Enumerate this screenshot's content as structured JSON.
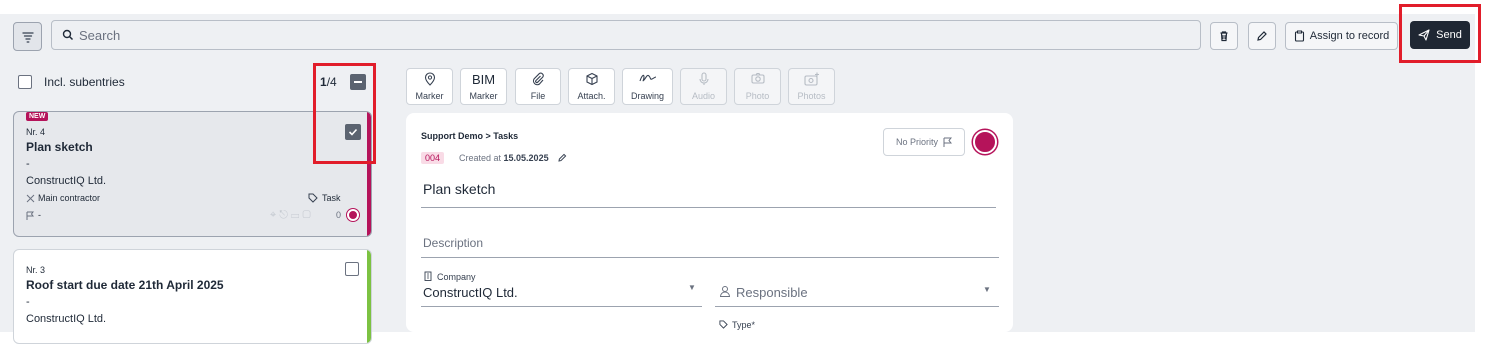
{
  "toolbar": {
    "search_placeholder": "Search",
    "assign_label": "Assign to record",
    "send_label": "Send"
  },
  "list": {
    "incl_subentries_label": "Incl. subentries",
    "page_current": "1",
    "page_total": "/4",
    "items": [
      {
        "badge": "NEW",
        "number": "Nr. 4",
        "title": "Plan sketch",
        "dash": "-",
        "company": "ConstructIQ Ltd.",
        "role": "Main contractor",
        "tag": "Task",
        "priority": "-",
        "comment_count": "0",
        "stripe_color": "#b5135a",
        "status_color": "#b5135a"
      },
      {
        "number": "Nr. 3",
        "title": "Roof start due date 21th April 2025",
        "dash": "-",
        "company": "ConstructIQ Ltd.",
        "stripe_color": "#7cc242"
      }
    ]
  },
  "tabs": [
    {
      "label": "Marker",
      "icon": "location-pin-icon",
      "enabled": true
    },
    {
      "label": "Marker",
      "icon_text": "BIM",
      "enabled": true
    },
    {
      "label": "File",
      "icon": "paperclip-icon",
      "enabled": true
    },
    {
      "label": "Attach.",
      "icon": "cube-icon",
      "enabled": true
    },
    {
      "label": "Drawing",
      "icon": "signature-icon",
      "enabled": true
    },
    {
      "label": "Audio",
      "icon": "microphone-icon",
      "enabled": false
    },
    {
      "label": "Photo",
      "icon": "camera-icon",
      "enabled": false
    },
    {
      "label": "Photos",
      "icon": "add-photo-icon",
      "enabled": false
    }
  ],
  "form": {
    "breadcrumb": "Support Demo > Tasks",
    "id_badge": "004",
    "created_prefix": "Created at ",
    "created_date": "15.05.2025",
    "priority_label": "No Priority",
    "status_color": "#b5135a",
    "title_value": "Plan sketch",
    "description_placeholder": "Description",
    "company_label": "Company",
    "company_value": "ConstructIQ Ltd.",
    "responsible_placeholder": "Responsible",
    "type_label": "Type*"
  }
}
